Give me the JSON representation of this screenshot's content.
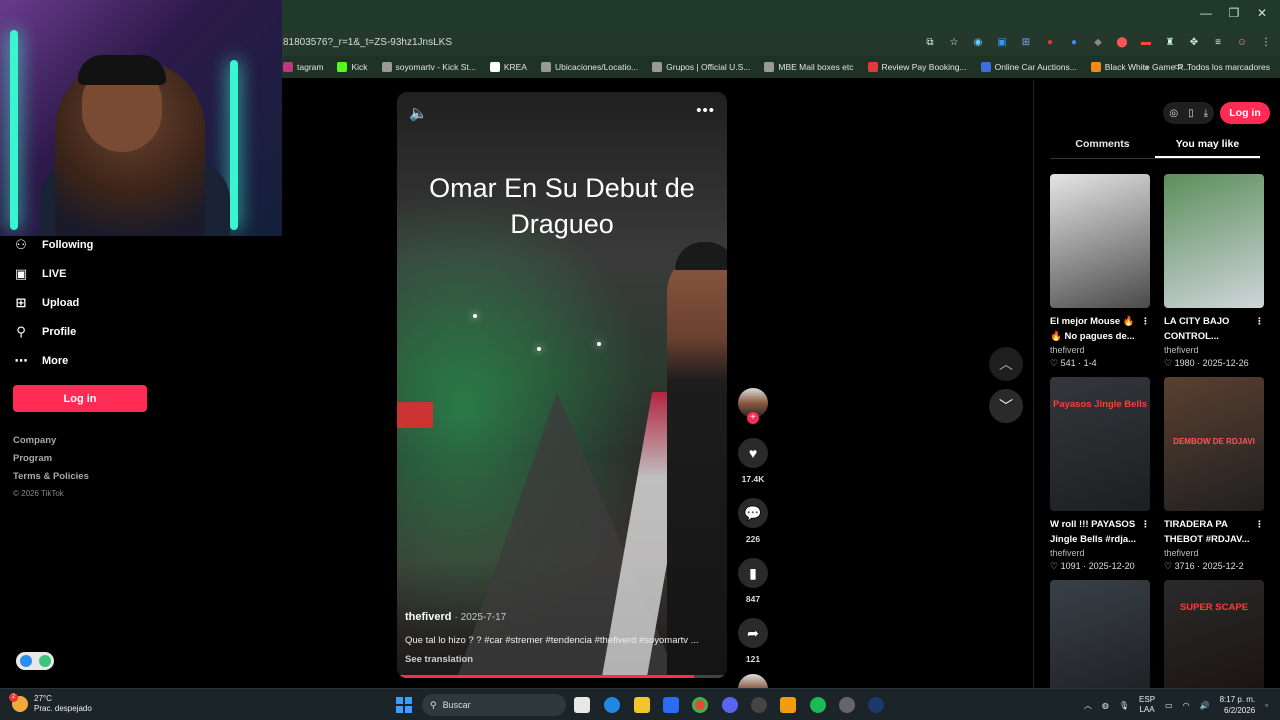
{
  "browser": {
    "url": "81803576?_r=1&_t=ZS-93hz1JnsLKS",
    "bookmarks": [
      {
        "label": "tagram",
        "color": "#c13584"
      },
      {
        "label": "Kick",
        "color": "#53fc18"
      },
      {
        "label": "soyomartv - Kick St...",
        "color": "#999999"
      },
      {
        "label": "KREA",
        "color": "#ffffff"
      },
      {
        "label": "Ubicaciones/Locatio...",
        "color": "#999999"
      },
      {
        "label": "Grupos | Official U.S...",
        "color": "#999999"
      },
      {
        "label": "MBE Mail boxes etc",
        "color": "#999999"
      },
      {
        "label": "Review Pay Booking...",
        "color": "#e23a3a"
      },
      {
        "label": "Online Car Auctions...",
        "color": "#3a6ee2"
      },
      {
        "label": "Black White Game R...",
        "color": "#f28a1b"
      }
    ],
    "all_bookmarks": "Todos los marcadores"
  },
  "nav": {
    "items": [
      {
        "label": "Following",
        "icon": "following-icon"
      },
      {
        "label": "LIVE",
        "icon": "live-icon"
      },
      {
        "label": "Upload",
        "icon": "upload-icon"
      },
      {
        "label": "Profile",
        "icon": "profile-icon"
      },
      {
        "label": "More",
        "icon": "more-icon"
      }
    ],
    "login": "Log in",
    "footer": [
      "Company",
      "Program",
      "Terms & Policies"
    ],
    "copyright": "© 2026 TikTok"
  },
  "video": {
    "title": "Omar En Su Debut de Dragueo",
    "author": "thefiverd",
    "date": "· 2025-7-17",
    "caption": "Que tal lo hizo ? ? #car #stremer #tendencia #thefiverd #soyomartv ...",
    "see_translation": "See translation",
    "progress_fraction": 0.9
  },
  "actions": {
    "likes": "17.4K",
    "comments": "226",
    "saves": "847",
    "shares": "121"
  },
  "right_panel": {
    "login": "Log in",
    "tabs": [
      "Comments",
      "You may like"
    ],
    "active_tab": "You may like",
    "cards": [
      {
        "title": "El mejor Mouse 🔥 🔥 No pagues de...",
        "author": "thefiverd",
        "stats": "♡ 541 · 1-4",
        "thumb": [
          "#e5e5e5",
          "#4a4a4a"
        ],
        "label": ""
      },
      {
        "title": "LA CITY BAJO CONTROL...",
        "author": "thefiverd",
        "stats": "♡ 1980 · 2025-12-26",
        "thumb": [
          "#5b8f5a",
          "#cfd5da"
        ],
        "label": ""
      },
      {
        "title": "W roll !!! PAYASOS Jingle Bells #rdja...",
        "author": "thefiverd",
        "stats": "♡ 1091 · 2025-12-20",
        "thumb": [
          "#33373b",
          "#1c1f22"
        ],
        "label": "Payasos Jingle Bells"
      },
      {
        "title": "TIRADERA PA THEBOT #RDJAV...",
        "author": "thefiverd",
        "stats": "♡ 3716 · 2025-12-2",
        "thumb": [
          "#5a4030",
          "#202020"
        ],
        "label": "DEMBOW DE RDJAVI"
      },
      {
        "title": "",
        "author": "",
        "stats": "",
        "thumb": [
          "#3a4048",
          "#1a1d20"
        ],
        "label": ""
      },
      {
        "title": "",
        "author": "",
        "stats": "",
        "thumb": [
          "#2a2a2a",
          "#1a1010"
        ],
        "label": "SUPER SCAPE"
      }
    ]
  },
  "taskbar": {
    "temp": "27°C",
    "weather": "Prac. despejado",
    "weather_badge": "2",
    "search_placeholder": "Buscar",
    "lang": "ESP",
    "lang2": "LAA",
    "time": "8:17 p. m.",
    "date": "6/2/2026"
  }
}
